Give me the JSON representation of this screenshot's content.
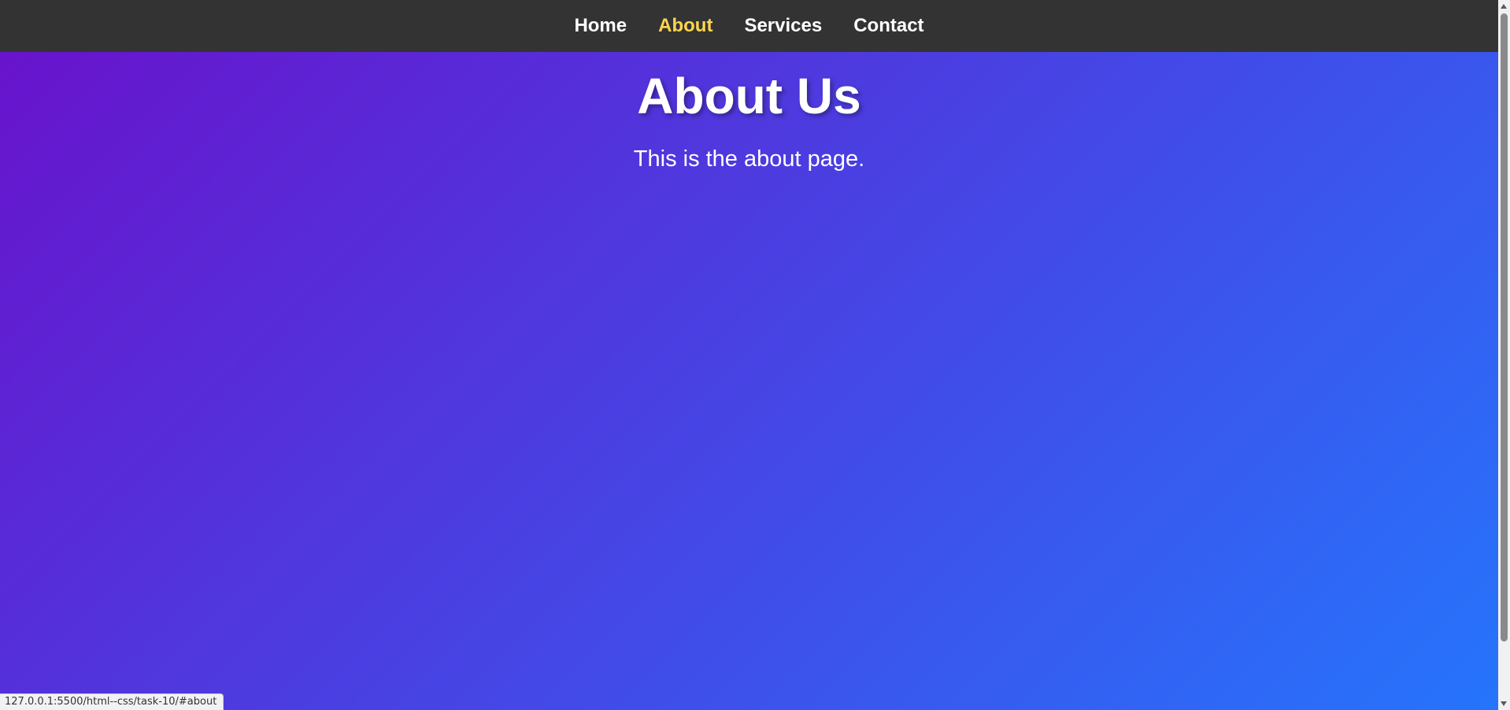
{
  "nav": {
    "items": [
      {
        "label": "Home",
        "active": false
      },
      {
        "label": "About",
        "active": true
      },
      {
        "label": "Services",
        "active": false
      },
      {
        "label": "Contact",
        "active": false
      }
    ]
  },
  "content": {
    "title": "About Us",
    "text": "This is the about page."
  },
  "status_bar": {
    "url": "127.0.0.1:5500/html--css/task-10/#about"
  },
  "colors": {
    "nav_background": "#333333",
    "active_link": "#ffd54f",
    "gradient_start": "#6a11cb",
    "gradient_end": "#2575fc",
    "text": "#ffffff"
  }
}
